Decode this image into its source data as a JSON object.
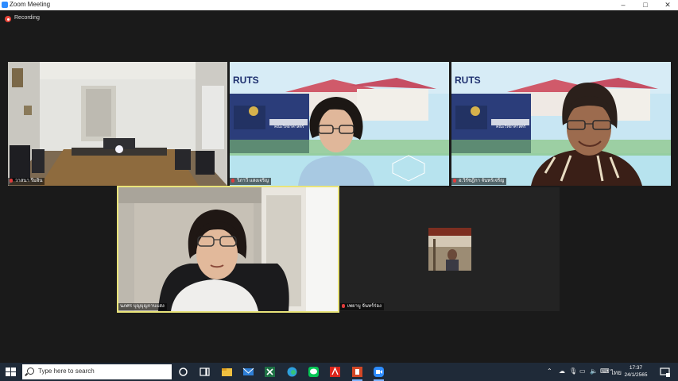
{
  "window": {
    "title": "Zoom Meeting",
    "controls": [
      "–",
      "□",
      "✕"
    ]
  },
  "recording": {
    "label": "Recording"
  },
  "participants": [
    {
      "name": "วาสนา รีมอิน"
    },
    {
      "name": "วิภาวี แสงเจริญ"
    },
    {
      "name": "อ.วิรัชฎีกา จันทร์เจริญ"
    },
    {
      "name": "นภศร บุญบุญกาบแสง"
    },
    {
      "name": "เพยาบู จันทร์ร่อง"
    }
  ],
  "backdrop": {
    "logo": "RUTS",
    "sign": "คณะวิทยาศาสตร์"
  },
  "taskbar": {
    "search_placeholder": "Type here to search",
    "apps": [
      "task-view-icon",
      "file-explorer-icon",
      "mail-icon",
      "excel-icon",
      "edge-icon",
      "line-icon",
      "acrobat-icon",
      "powerpoint-icon",
      "zoom-icon"
    ],
    "language": "ไทย",
    "time": "17:37",
    "date": "24/1/2565"
  },
  "colors": {
    "accent": "#2d8cff",
    "active_speaker": "#e9e47a",
    "taskbar": "#1f2a38"
  }
}
